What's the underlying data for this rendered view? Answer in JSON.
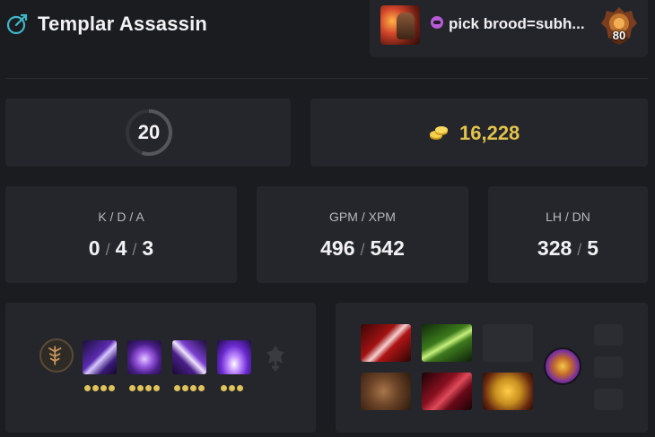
{
  "header": {
    "hero_icon": "templar-assassin-attribute-icon",
    "hero_name": "Templar Assassin"
  },
  "player": {
    "name": "pick brood=subh...",
    "avatar": "player-avatar",
    "tag_icon": "purple-mask-icon",
    "rank_medal": "rank-medal-icon",
    "rank_number": "80"
  },
  "level": {
    "value": "20",
    "progress_fraction": 0.55
  },
  "gold": {
    "icon": "gold-coins-icon",
    "value": "16,228",
    "color": "#e2c34b"
  },
  "stats": {
    "kda": {
      "label": "K / D / A",
      "kills": "0",
      "deaths": "4",
      "assists": "3",
      "sep": "/"
    },
    "gpm_xpm": {
      "label": "GPM / XPM",
      "gpm": "496",
      "xpm": "542",
      "sep": "/"
    },
    "lh_dn": {
      "label": "LH / DN",
      "lh": "328",
      "dn": "5",
      "sep": "/"
    }
  },
  "abilities": {
    "talent_icon": "talent-tree-icon",
    "shard_icon": "aghanims-shard-icon",
    "skills": [
      {
        "icon": "refraction-icon",
        "level": 4
      },
      {
        "icon": "meld-icon",
        "level": 4
      },
      {
        "icon": "psi-blades-icon",
        "level": 4
      },
      {
        "icon": "psionic-trap-icon",
        "level": 3
      }
    ]
  },
  "items": {
    "slots": [
      "desolator-icon",
      "butterfly-icon",
      "empty-slot",
      "power-treads-icon",
      "bloodthorn-icon",
      "hand-of-midas-icon"
    ],
    "neutral": "neutral-item-icon",
    "backpack": [
      "empty-backpack-slot",
      "empty-backpack-slot",
      "empty-backpack-slot"
    ]
  },
  "colors": {
    "background": "#1b1c20",
    "panel": "#25262b",
    "ability_dot": "#e0c35a",
    "hero_icon_color": "#3fb7c9"
  }
}
